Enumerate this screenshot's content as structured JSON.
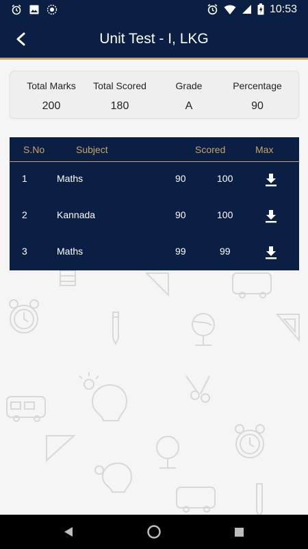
{
  "status_bar": {
    "time": "10:53",
    "left_icons": [
      "alarm-icon",
      "image-icon",
      "sync-icon"
    ],
    "right_icons": [
      "alarm-icon",
      "wifi-icon",
      "signal-icon",
      "battery-icon"
    ]
  },
  "header": {
    "title": "Unit Test - I, LKG",
    "back_icon": "back-arrow-icon"
  },
  "summary": {
    "total_marks_label": "Total Marks",
    "total_marks_value": "200",
    "total_scored_label": "Total Scored",
    "total_scored_value": "180",
    "grade_label": "Grade",
    "grade_value": "A",
    "percentage_label": "Percentage",
    "percentage_value": "90"
  },
  "table": {
    "headers": {
      "sno": "S.No",
      "subject": "Subject",
      "scored": "Scored",
      "max": "Max"
    },
    "rows": [
      {
        "sno": "1",
        "subject": "Maths",
        "scored": "90",
        "max": "100"
      },
      {
        "sno": "2",
        "subject": "Kannada",
        "scored": "90",
        "max": "100"
      },
      {
        "sno": "3",
        "subject": "Maths",
        "scored": "99",
        "max": "99"
      }
    ],
    "row_action_icon": "download-icon"
  },
  "nav_bar": {
    "icons": [
      "back-triangle-icon",
      "home-circle-icon",
      "recents-square-icon"
    ]
  },
  "colors": {
    "primary": "#0b1f44",
    "accent": "#c8a46b",
    "background": "#f5f5f5"
  }
}
